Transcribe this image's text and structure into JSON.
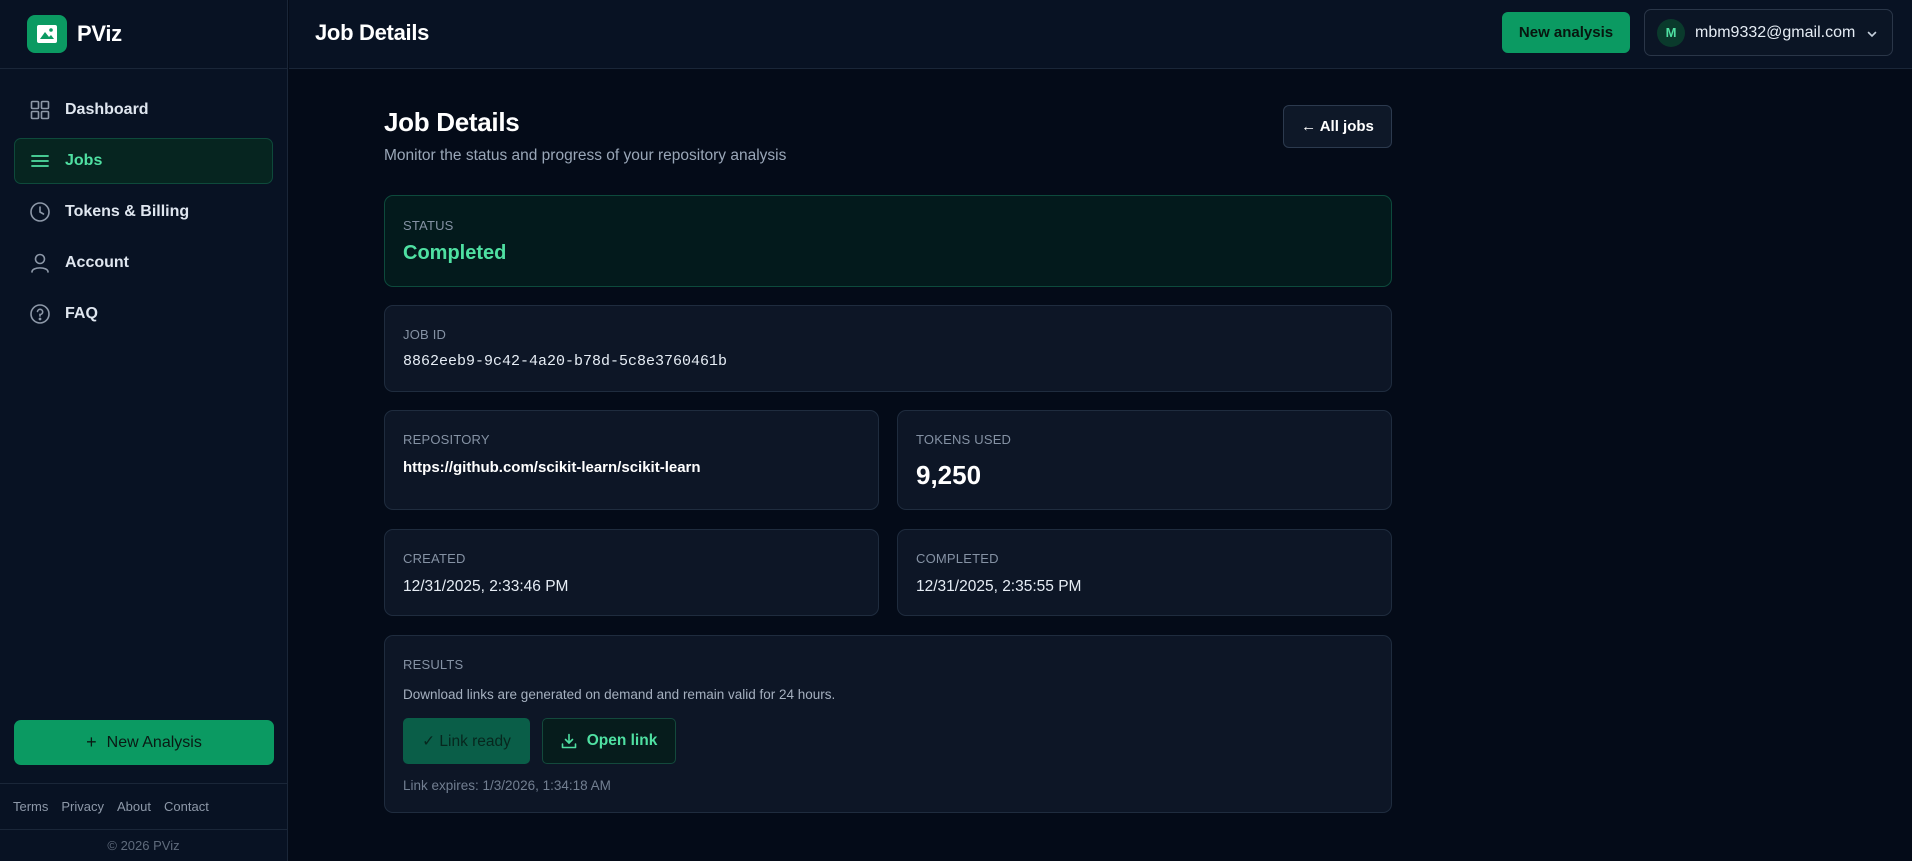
{
  "app": {
    "name": "PViz"
  },
  "sidebar": {
    "items": [
      {
        "label": "Dashboard",
        "icon": "grid-icon",
        "active": false
      },
      {
        "label": "Jobs",
        "icon": "list-icon",
        "active": true
      },
      {
        "label": "Tokens & Billing",
        "icon": "clock-icon",
        "active": false
      },
      {
        "label": "Account",
        "icon": "user-icon",
        "active": false
      },
      {
        "label": "FAQ",
        "icon": "help-circle-icon",
        "active": false
      }
    ],
    "new_analysis_label": "New Analysis",
    "footer_links": [
      "Terms",
      "Privacy",
      "About",
      "Contact"
    ],
    "copyright": "© 2026 PViz"
  },
  "header": {
    "title": "Job Details",
    "new_analysis_label": "New analysis",
    "user": {
      "initial": "M",
      "email": "mbm9332@gmail.com"
    }
  },
  "main": {
    "title": "Job Details",
    "subtitle": "Monitor the status and progress of your repository analysis",
    "back_label": "← All jobs",
    "status": {
      "label": "STATUS",
      "value": "Completed"
    },
    "job_id": {
      "label": "JOB ID",
      "value": "8862eeb9-9c42-4a20-b78d-5c8e3760461b"
    },
    "repository": {
      "label": "REPOSITORY",
      "value": "https://github.com/scikit-learn/scikit-learn"
    },
    "tokens": {
      "label": "TOKENS USED",
      "value": "9,250"
    },
    "created": {
      "label": "CREATED",
      "value": "12/31/2025, 2:33:46 PM"
    },
    "completed": {
      "label": "COMPLETED",
      "value": "12/31/2025, 2:35:55 PM"
    },
    "results": {
      "label": "RESULTS",
      "note": "Download links are generated on demand and remain valid for 24 hours.",
      "link_ready_label": "✓ Link ready",
      "open_link_label": "Open link",
      "expires": "Link expires: 1/3/2026, 1:34:18 AM"
    }
  },
  "colors": {
    "accent": "#0b9a62",
    "accent_text": "#4fe0a2",
    "background": "#040b18",
    "panel": "#0d1626"
  }
}
